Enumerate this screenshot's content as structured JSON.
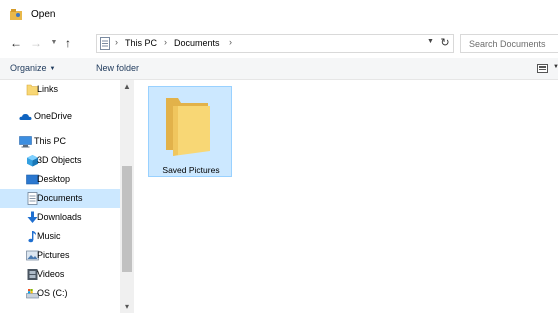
{
  "window": {
    "title": "Open"
  },
  "navigation": {
    "back_icon": "arrow-left",
    "forward_icon": "arrow-right",
    "recent_icon": "chevron-down",
    "up_icon": "arrow-up",
    "breadcrumb": [
      "This PC",
      "Documents"
    ],
    "separator": "›",
    "refresh_icon": "refresh"
  },
  "search": {
    "placeholder": "Search Documents"
  },
  "toolbar": {
    "organize_label": "Organize",
    "new_folder_label": "New folder",
    "view_icon": "view-options"
  },
  "sidebar": {
    "items": [
      {
        "label": "Links",
        "icon": "folder"
      },
      {
        "label": "OneDrive",
        "icon": "cloud"
      },
      {
        "label": "This PC",
        "icon": "computer"
      },
      {
        "label": "3D Objects",
        "icon": "cube"
      },
      {
        "label": "Desktop",
        "icon": "desktop"
      },
      {
        "label": "Documents",
        "icon": "document",
        "selected": true
      },
      {
        "label": "Downloads",
        "icon": "download-arrow"
      },
      {
        "label": "Music",
        "icon": "music-note"
      },
      {
        "label": "Pictures",
        "icon": "picture"
      },
      {
        "label": "Videos",
        "icon": "film"
      },
      {
        "label": "OS (C:)",
        "icon": "drive"
      }
    ]
  },
  "files": [
    {
      "name": "Saved Pictures",
      "type": "folder",
      "selected": true
    }
  ],
  "colors": {
    "selection": "#cce8ff",
    "selection_border": "#99d1ff",
    "folder": "#f8d775",
    "link_blue": "#1e395b"
  }
}
